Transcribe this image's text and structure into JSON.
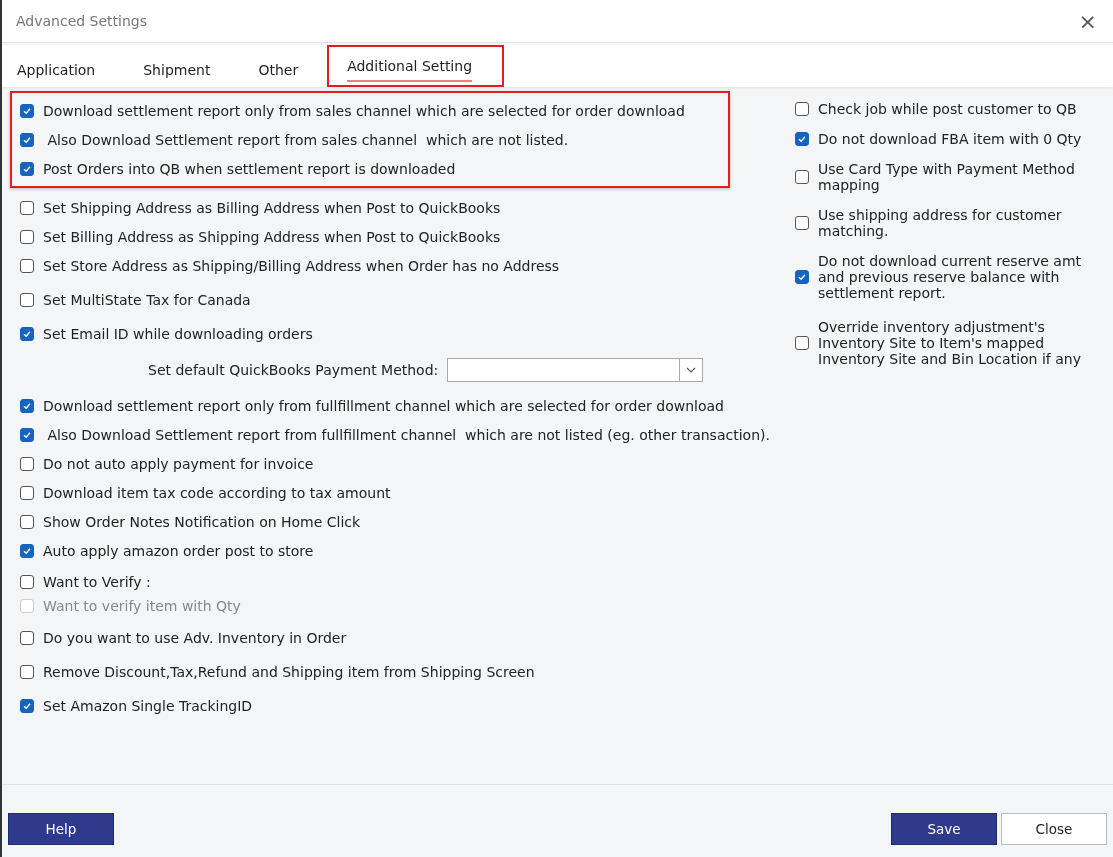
{
  "window": {
    "title": "Advanced Settings",
    "close": "×"
  },
  "tabs": [
    {
      "label": "Application",
      "selected": false,
      "highlighted": false
    },
    {
      "label": "Shipment",
      "selected": false,
      "highlighted": false
    },
    {
      "label": "Other",
      "selected": false,
      "highlighted": false
    },
    {
      "label": "Additional Setting",
      "selected": true,
      "highlighted": true
    }
  ],
  "left_groups": [
    {
      "highlighted": true,
      "compact": false,
      "items": [
        {
          "kind": "checkbox",
          "label": "Download settlement report only from sales channel which are selected for order download",
          "checked": true,
          "disabled": false
        },
        {
          "kind": "checkbox",
          "label": " Also Download Settlement report from sales channel  which are not listed.",
          "checked": true,
          "disabled": false
        },
        {
          "kind": "checkbox",
          "label": "Post Orders into QB when settlement report is downloaded",
          "checked": true,
          "disabled": false
        }
      ]
    },
    {
      "highlighted": false,
      "compact": false,
      "items": [
        {
          "kind": "checkbox",
          "label": "Set Shipping Address as Billing Address when Post to QuickBooks",
          "checked": false,
          "disabled": false
        },
        {
          "kind": "checkbox",
          "label": "Set Billing Address as Shipping Address when Post to QuickBooks",
          "checked": false,
          "disabled": false
        },
        {
          "kind": "checkbox",
          "label": "Set Store Address as Shipping/Billing Address when Order has no Address",
          "checked": false,
          "disabled": false
        }
      ]
    },
    {
      "highlighted": false,
      "compact": false,
      "items": [
        {
          "kind": "checkbox",
          "label": "Set MultiState Tax for Canada",
          "checked": false,
          "disabled": false
        }
      ]
    },
    {
      "highlighted": false,
      "compact": false,
      "items": [
        {
          "kind": "checkbox",
          "label": "Set Email ID while downloading orders",
          "checked": true,
          "disabled": false
        }
      ]
    },
    {
      "highlighted": false,
      "compact": false,
      "items": [
        {
          "kind": "select",
          "label": "Set default QuickBooks Payment Method:"
        }
      ]
    },
    {
      "highlighted": false,
      "compact": false,
      "items": [
        {
          "kind": "checkbox",
          "label": "Download settlement report only from fullfillment channel which are selected for order download",
          "checked": true,
          "disabled": false
        },
        {
          "kind": "checkbox",
          "label": " Also Download Settlement report from fullfillment channel  which are not listed (eg. other transaction).",
          "checked": true,
          "disabled": false
        },
        {
          "kind": "checkbox",
          "label": "Do not auto apply payment for invoice",
          "checked": false,
          "disabled": false
        },
        {
          "kind": "checkbox",
          "label": "Download item tax code according to tax amount",
          "checked": false,
          "disabled": false
        },
        {
          "kind": "checkbox",
          "label": "Show Order Notes Notification on Home Click",
          "checked": false,
          "disabled": false
        },
        {
          "kind": "checkbox",
          "label": "Auto apply amazon order post to store",
          "checked": true,
          "disabled": false
        }
      ]
    },
    {
      "highlighted": false,
      "compact": true,
      "items": [
        {
          "kind": "checkbox",
          "label": "Want to Verify :",
          "checked": false,
          "disabled": false
        },
        {
          "kind": "checkbox",
          "label": "Want to verify item with Qty",
          "checked": false,
          "disabled": true
        }
      ]
    },
    {
      "highlighted": false,
      "compact": false,
      "items": [
        {
          "kind": "checkbox",
          "label": "Do you want to use Adv. Inventory in Order",
          "checked": false,
          "disabled": false
        }
      ]
    },
    {
      "highlighted": false,
      "compact": false,
      "items": [
        {
          "kind": "checkbox",
          "label": "Remove Discount,Tax,Refund and Shipping item from Shipping Screen",
          "checked": false,
          "disabled": false
        }
      ]
    },
    {
      "highlighted": false,
      "compact": false,
      "items": [
        {
          "kind": "checkbox",
          "label": "Set Amazon Single TrackingID",
          "checked": true,
          "disabled": false
        }
      ]
    }
  ],
  "right_items": [
    {
      "label": "Check job while post customer to QB",
      "checked": false
    },
    {
      "label": "Do not download FBA item with 0 Qty",
      "checked": true
    },
    {
      "label": "Use Card Type with Payment Method mapping",
      "checked": false
    },
    {
      "label": "Use shipping address for customer matching.",
      "checked": false
    },
    {
      "label": "Do not download current reserve amt and previous reserve balance with settlement report.",
      "checked": true
    },
    {
      "label": "Override inventory adjustment's Inventory Site to Item's mapped Inventory Site and Bin Location if any",
      "checked": false
    }
  ],
  "buttons": [
    {
      "label": "Help",
      "kind": "primary"
    },
    {
      "label": "Save",
      "kind": "primary"
    },
    {
      "label": "Close",
      "kind": "secondary"
    }
  ]
}
